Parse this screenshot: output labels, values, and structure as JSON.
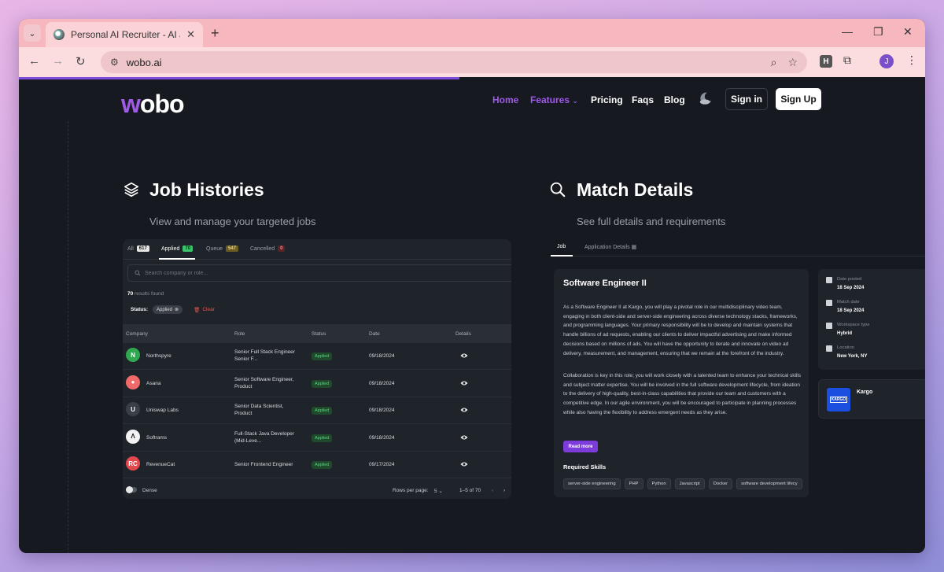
{
  "browser": {
    "tab_title": "Personal AI Recruiter - AI Job Se",
    "url": "wobo.ai",
    "profile_initial": "J",
    "extension_letter": "H"
  },
  "nav": {
    "logo": "wobo",
    "links": [
      "Home",
      "Features",
      "Pricing",
      "Faqs",
      "Blog"
    ],
    "active": "Home",
    "sign_in": "Sign in",
    "sign_up": "Sign Up",
    "accent": "#9f5ae8"
  },
  "job_histories": {
    "title": "Job Histories",
    "subtitle": "View and manage your targeted jobs",
    "tabs": [
      {
        "label": "All",
        "count": "617"
      },
      {
        "label": "Applied",
        "count": "70"
      },
      {
        "label": "Queue",
        "count": "547"
      },
      {
        "label": "Cancelled",
        "count": "0"
      }
    ],
    "search_placeholder": "Search company or role...",
    "results_count": "70",
    "results_label": "results found",
    "status_label": "Status:",
    "status_chip": "Applied",
    "clear_label": "Clear",
    "columns": [
      "Company",
      "Role",
      "Status",
      "Date",
      "Details"
    ],
    "rows": [
      {
        "logo": "N",
        "company": "Northspyre",
        "role_line1": "Senior Full Stack Engineer",
        "role_line2": "Senior F...",
        "status": "Applied",
        "date": "09/18/2024",
        "color": "#2fa84f"
      },
      {
        "logo": "●",
        "company": "Asana",
        "role_line1": "Senior Software Engineer,",
        "role_line2": "Product",
        "status": "Applied",
        "date": "09/18/2024",
        "color": "#f06a6a"
      },
      {
        "logo": "U",
        "company": "Uniswap Labs",
        "role_line1": "Senior Data Scientist,",
        "role_line2": "Product",
        "status": "Applied",
        "date": "09/18/2024",
        "color": "#3a3f47"
      },
      {
        "logo": "Λ",
        "company": "Softrams",
        "role_line1": "Full-Stack Java Developer",
        "role_line2": "(Mid-Leve...",
        "status": "Applied",
        "date": "09/18/2024",
        "color": "#f2f2f2"
      },
      {
        "logo": "RC",
        "company": "RevenueCat",
        "role_line1": "Senior Frontend Engineer",
        "role_line2": "",
        "status": "Applied",
        "date": "09/17/2024",
        "color": "#e2484e"
      }
    ],
    "dense_label": "Dense",
    "rows_per_page_label": "Rows per page:",
    "rows_per_page": "5",
    "pagination": "1–5 of 70"
  },
  "match_details": {
    "title": "Match Details",
    "subtitle": "See full details and requirements",
    "tabs": [
      "Job",
      "Application Details"
    ],
    "job_title": "Software Engineer II",
    "paragraph1": "As a Software Engineer II at Kargo, you will play a pivotal role in our multidisciplinary video team, engaging in both client-side and server-side engineering across diverse technology stacks, frameworks, and programming languages. Your primary responsibility will be to develop and maintain systems that handle billions of ad requests, enabling our clients to deliver impactful advertising and make informed decisions based on millions of ads. You will have the opportunity to iterate and innovate on video ad delivery, measurement, and management, ensuring that we remain at the forefront of the industry.",
    "paragraph2": "Collaboration is key in this role; you will work closely with a talented team to enhance your technical skills and subject matter expertise. You will be involved in the full software development lifecycle, from ideation to the delivery of high-quality, best-in-class capabilities that provide our team and customers with a competitive edge. In our agile environment, you will be encouraged to participate in planning processes while also having the flexibility to address emergent needs as they arise.",
    "read_more": "Read more",
    "required_skills_title": "Required Skills",
    "skills": [
      "server-side engineering",
      "PHP",
      "Python",
      "Javascript",
      "Docker",
      "software development lifecy"
    ],
    "meta": [
      {
        "label": "Date posted",
        "value": "18 Sep 2024",
        "icon": "calendar-icon"
      },
      {
        "label": "Match date",
        "value": "18 Sep 2024",
        "icon": "calendar-check-icon"
      },
      {
        "label": "Workspace type",
        "value": "Hybrid",
        "icon": "building-icon"
      },
      {
        "label": "Location",
        "value": "New York, NY",
        "icon": "location-arrow-icon"
      }
    ],
    "company_name": "Kargo",
    "company_logo_text": "KARGO"
  }
}
